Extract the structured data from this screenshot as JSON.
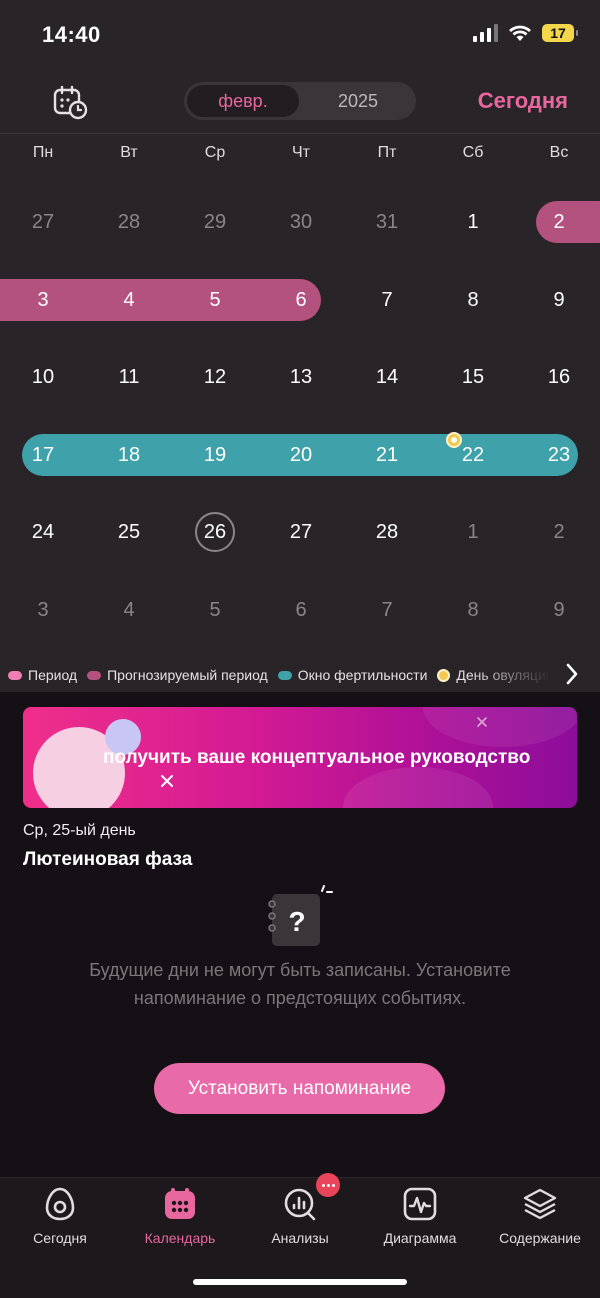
{
  "status": {
    "time": "14:40",
    "battery": "17"
  },
  "header": {
    "month": "февр.",
    "year": "2025",
    "today_label": "Сегодня"
  },
  "weekdays": [
    "Пн",
    "Вт",
    "Ср",
    "Чт",
    "Пт",
    "Сб",
    "Вс"
  ],
  "weeks": [
    [
      {
        "d": "27",
        "o": true
      },
      {
        "d": "28",
        "o": true
      },
      {
        "d": "29",
        "o": true
      },
      {
        "d": "30",
        "o": true
      },
      {
        "d": "31",
        "o": true
      },
      {
        "d": "1",
        "o": false
      },
      {
        "d": "2",
        "o": false
      }
    ],
    [
      {
        "d": "3",
        "o": false
      },
      {
        "d": "4",
        "o": false
      },
      {
        "d": "5",
        "o": false
      },
      {
        "d": "6",
        "o": false
      },
      {
        "d": "7",
        "o": false
      },
      {
        "d": "8",
        "o": false
      },
      {
        "d": "9",
        "o": false
      }
    ],
    [
      {
        "d": "10",
        "o": false
      },
      {
        "d": "11",
        "o": false
      },
      {
        "d": "12",
        "o": false
      },
      {
        "d": "13",
        "o": false
      },
      {
        "d": "14",
        "o": false
      },
      {
        "d": "15",
        "o": false
      },
      {
        "d": "16",
        "o": false
      }
    ],
    [
      {
        "d": "17",
        "o": false
      },
      {
        "d": "18",
        "o": false
      },
      {
        "d": "19",
        "o": false
      },
      {
        "d": "20",
        "o": false
      },
      {
        "d": "21",
        "o": false
      },
      {
        "d": "22",
        "o": false
      },
      {
        "d": "23",
        "o": false
      }
    ],
    [
      {
        "d": "24",
        "o": false
      },
      {
        "d": "25",
        "o": false
      },
      {
        "d": "26",
        "o": false
      },
      {
        "d": "27",
        "o": false
      },
      {
        "d": "28",
        "o": false
      },
      {
        "d": "1",
        "o": true
      },
      {
        "d": "2",
        "o": true
      }
    ],
    [
      {
        "d": "3",
        "o": true
      },
      {
        "d": "4",
        "o": true
      },
      {
        "d": "5",
        "o": true
      },
      {
        "d": "6",
        "o": true
      },
      {
        "d": "7",
        "o": true
      },
      {
        "d": "8",
        "o": true
      },
      {
        "d": "9",
        "o": true
      }
    ]
  ],
  "marked_today": "26",
  "ovulation_day": "22",
  "colors": {
    "accent": "#e8679f",
    "period": "#f07eb4",
    "predicted_period": "#b4527f",
    "fertile_window": "#3fa2aa",
    "ovulation": "#f3c84e"
  },
  "legend": [
    {
      "label": "Период",
      "color": "#f07eb4"
    },
    {
      "label": "Прогнозируемый период",
      "color": "#b4527f"
    },
    {
      "label": "Окно фертильности",
      "color": "#3fa2aa"
    },
    {
      "label": "День овуляции",
      "color": "#f3c84e"
    }
  ],
  "banner": {
    "text": "получить ваше концептуальное руководство"
  },
  "day_info": {
    "date": "Ср, 25-ый день",
    "phase": "Лютеиновая фаза"
  },
  "empty_state": {
    "icon": "question-notebook-icon",
    "text": "Будущие дни не могут быть записаны. Установите напоминание о предстоящих событиях."
  },
  "reminder_button": "Установить напоминание",
  "nav": [
    {
      "label": "Сегодня",
      "icon": "egg-icon",
      "active": false
    },
    {
      "label": "Календарь",
      "icon": "calendar-icon",
      "active": true
    },
    {
      "label": "Анализы",
      "icon": "analysis-icon",
      "active": false
    },
    {
      "label": "Диаграмма",
      "icon": "chart-icon",
      "active": false
    },
    {
      "label": "Содержание",
      "icon": "layers-icon",
      "active": false
    }
  ]
}
